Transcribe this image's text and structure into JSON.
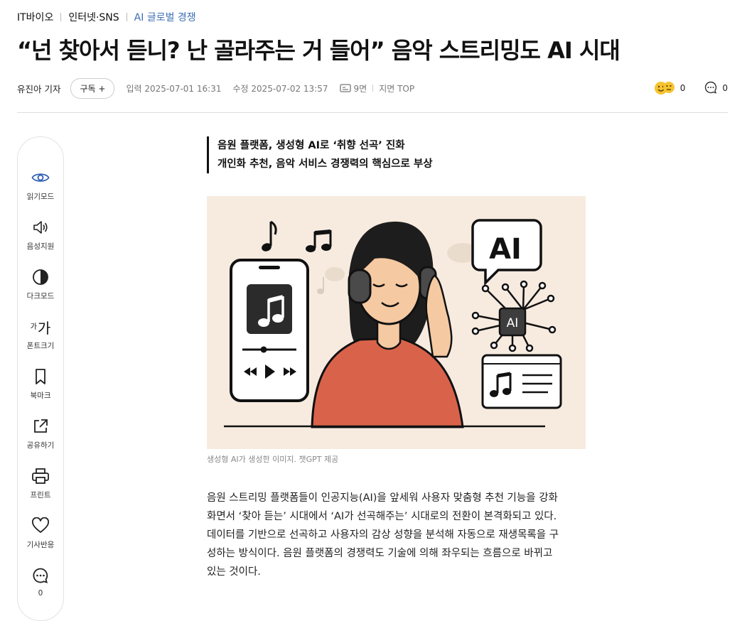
{
  "breadcrumb": [
    "IT바이오",
    "인터넷·SNS",
    "AI 글로벌 경쟁"
  ],
  "headline": "“넌 찾아서 듣니? 난 골라주는 거 들어” 음악 스트리밍도 AI 시대",
  "meta": {
    "reporter": "유진아 기자",
    "subscribe": "구독 +",
    "input_time": "입력 2025-07-01 16:31",
    "edit_time": "수정 2025-07-02 13:57",
    "page": "9면",
    "section": "지면 TOP",
    "reaction_count": "0",
    "comment_count": "0"
  },
  "tools": [
    {
      "label": "읽기모드",
      "icon": "eye-icon"
    },
    {
      "label": "음성지원",
      "icon": "speaker-icon"
    },
    {
      "label": "다크모드",
      "icon": "dark-mode-icon"
    },
    {
      "label": "폰트크기",
      "icon": "font-size-icon"
    },
    {
      "label": "북마크",
      "icon": "bookmark-icon"
    },
    {
      "label": "공유하기",
      "icon": "share-icon"
    },
    {
      "label": "프린트",
      "icon": "print-icon"
    },
    {
      "label": "기사반응",
      "icon": "heart-icon"
    },
    {
      "label": "0",
      "icon": "comment-icon"
    }
  ],
  "font_icon_text": {
    "small": "가",
    "big": "가"
  },
  "summary": [
    "음원 플랫폼, 생성형 AI로 ‘취향 선곡’ 진화",
    "개인화 추천, 음악 서비스 경쟁력의 핵심으로 부상"
  ],
  "image": {
    "bubble_text": "AI",
    "chip_text": "AI",
    "caption": "생성형 AI가 생성한 이미지. 챗GPT 제공"
  },
  "body": [
    "음원 스트리밍 플랫폼들이 인공지능(AI)을 앞세워 사용자 맞춤형 추천 기능을 강화",
    "화면서 ‘찾아 듣는’ 시대에서 ‘AI가 선곡해주는’ 시대로의 전환이 본격화되고 있다.",
    "데이터를 기반으로 선곡하고 사용자의 감상 성향을 분석해 자동으로 재생목록을 구",
    "성하는 방식이다. 음원 플랫폼의 경쟁력도 기술에 의해 좌우되는 흐름으로 바뀌고",
    "있는 것이다."
  ],
  "colors": {
    "accent": "#3d6fb6",
    "hero_bg": "#f7ebe0",
    "shirt": "#d9634a"
  }
}
